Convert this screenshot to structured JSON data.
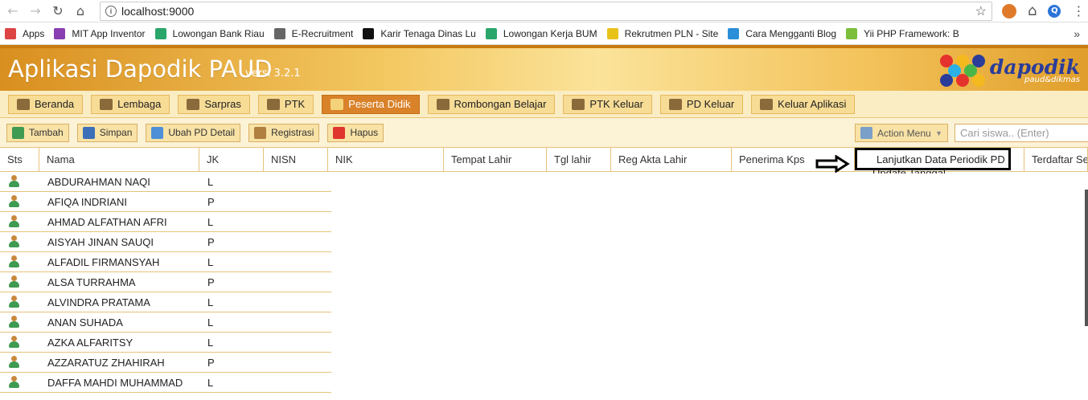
{
  "browser": {
    "url": "localhost:9000",
    "bookmarks": [
      {
        "label": "Apps",
        "icon": "apps-grid-icon",
        "color": "#d44"
      },
      {
        "label": "MIT App Inventor",
        "icon": "mit-app-inventor-icon",
        "color": "#8a3fb0"
      },
      {
        "label": "Lowongan Bank Riau",
        "icon": "clock-icon",
        "color": "#2aa66a"
      },
      {
        "label": "E-Recruitment",
        "icon": "document-icon",
        "color": "#666"
      },
      {
        "label": "Karir Tenaga Dinas Lu",
        "icon": "k-logo-icon",
        "color": "#111"
      },
      {
        "label": "Lowongan Kerja BUM",
        "icon": "clock-icon",
        "color": "#2aa66a"
      },
      {
        "label": "Rekrutmen PLN - Site",
        "icon": "pln-icon",
        "color": "#e7c21a"
      },
      {
        "label": "Cara Mengganti Blog",
        "icon": "blog-s-icon",
        "color": "#2a8fd8"
      },
      {
        "label": "Yii PHP Framework: B",
        "icon": "yii-icon",
        "color": "#7bbf3a"
      }
    ],
    "more": "»"
  },
  "app": {
    "title": "Aplikasi Dapodik PAUD",
    "version": "versi 3.2.1",
    "logo_text": "dapodik",
    "logo_sub": "paud&dikmas"
  },
  "nav": [
    {
      "label": "Beranda",
      "name": "tab-beranda",
      "active": false
    },
    {
      "label": "Lembaga",
      "name": "tab-lembaga",
      "active": false
    },
    {
      "label": "Sarpras",
      "name": "tab-sarpras",
      "active": false
    },
    {
      "label": "PTK",
      "name": "tab-ptk",
      "active": false
    },
    {
      "label": "Peserta Didik",
      "name": "tab-peserta-didik",
      "active": true
    },
    {
      "label": "Rombongan Belajar",
      "name": "tab-rombongan-belajar",
      "active": false
    },
    {
      "label": "PTK Keluar",
      "name": "tab-ptk-keluar",
      "active": false
    },
    {
      "label": "PD Keluar",
      "name": "tab-pd-keluar",
      "active": false
    },
    {
      "label": "Keluar Aplikasi",
      "name": "tab-keluar-aplikasi",
      "active": false
    }
  ],
  "toolbar": {
    "tambah": "Tambah",
    "simpan": "Simpan",
    "ubah": "Ubah PD Detail",
    "registrasi": "Registrasi",
    "hapus": "Hapus",
    "action_menu": "Action Menu",
    "search_placeholder": "Cari siswa.. (Enter)"
  },
  "dropdown": {
    "selected": "Lanjutkan Data Periodik PD",
    "next_partial": "Update Tanggal..."
  },
  "table": {
    "columns": [
      {
        "label": "Sts",
        "w": 49
      },
      {
        "label": "Nama",
        "w": 199
      },
      {
        "label": "JK",
        "w": 80
      },
      {
        "label": "NISN",
        "w": 80
      },
      {
        "label": "NIK",
        "w": 144
      },
      {
        "label": "Tempat Lahir",
        "w": 128
      },
      {
        "label": "Tgl lahir",
        "w": 80
      },
      {
        "label": "Reg Akta Lahir",
        "w": 150
      },
      {
        "label": "Penerima Kps",
        "w": 153
      },
      {
        "label": "",
        "w": 211
      },
      {
        "label": "Terdaftar Se",
        "w": 79
      }
    ],
    "rows": [
      {
        "nama": "ABDURAHMAN NAQI",
        "jk": "L"
      },
      {
        "nama": "AFIQA INDRIANI",
        "jk": "P"
      },
      {
        "nama": "AHMAD ALFATHAN AFRI",
        "jk": "L"
      },
      {
        "nama": "AISYAH JINAN SAUQI",
        "jk": "P"
      },
      {
        "nama": "ALFADIL FIRMANSYAH",
        "jk": "L"
      },
      {
        "nama": "ALSA TURRAHMA",
        "jk": "P"
      },
      {
        "nama": "ALVINDRA PRATAMA",
        "jk": "L"
      },
      {
        "nama": "ANAN SUHADA",
        "jk": "L"
      },
      {
        "nama": "AZKA ALFARITSY",
        "jk": "L"
      },
      {
        "nama": "AZZARATUZ ZHAHIRAH",
        "jk": "P"
      },
      {
        "nama": "DAFFA MAHDI MUHAMMAD",
        "jk": "L"
      }
    ]
  }
}
